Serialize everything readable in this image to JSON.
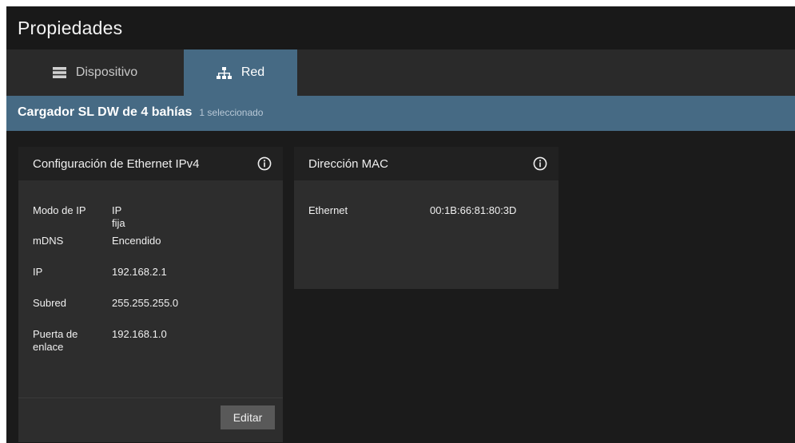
{
  "window": {
    "title": "Propiedades"
  },
  "tabs": [
    {
      "label": "Dispositivo",
      "icon": "server-icon",
      "active": false
    },
    {
      "label": "Red",
      "icon": "network-icon",
      "active": true
    }
  ],
  "subheader": {
    "device_name": "Cargador SL DW de 4 bahías",
    "selection": "1 seleccionado"
  },
  "ipv4_card": {
    "title": "Configuración de Ethernet IPv4",
    "rows": [
      {
        "label": "Modo de IP",
        "value": "IP fija"
      },
      {
        "label": "mDNS",
        "value": "Encendido"
      },
      {
        "label": "IP",
        "value": "192.168.2.1"
      },
      {
        "label": "Subred",
        "value": "255.255.255.0"
      },
      {
        "label": "Puerta de enlace",
        "value": "192.168.1.0"
      }
    ],
    "edit_label": "Editar"
  },
  "mac_card": {
    "title": "Dirección MAC",
    "rows": [
      {
        "label": "Ethernet",
        "value": "00:1B:66:81:80:3D"
      }
    ]
  },
  "colors": {
    "accent": "#466a84",
    "background": "#1b1b1b",
    "card": "#2d2d2d"
  }
}
